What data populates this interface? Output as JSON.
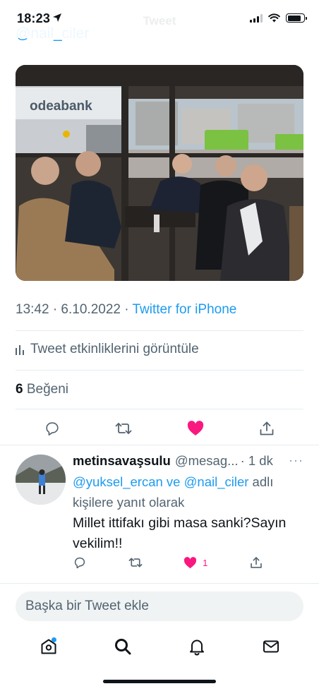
{
  "status_bar": {
    "time": "18:23",
    "battery_level": 0.85
  },
  "header": {
    "faded_title": "Tweet"
  },
  "tweet": {
    "cut_mention": "@nail_ciler",
    "timestamp": "13:42 · 6.10.2022 · ",
    "source": "Twitter for iPhone",
    "activity_label": "Tweet etkinliklerini görüntüle",
    "like_count": "6",
    "like_label": " Beğeni"
  },
  "reply": {
    "display_name": "metinsavaşsulu",
    "handle": "@mesag...",
    "time": " · 1 dk",
    "more": "···",
    "mention_1": "@yuksel_ercan",
    "connector": " ve ",
    "mention_2": "@nail_ciler",
    "reply_suffix": " adlı kişilere yanıt olarak",
    "text": "Millet ittifakı gibi masa sanki?Sayın vekilim!!",
    "like_count": "1"
  },
  "compose": {
    "placeholder": "Başka bir Tweet ekle"
  },
  "colors": {
    "accent": "#1d9bf0",
    "like": "#f91880",
    "text": "#0f1419",
    "secondary": "#536471"
  },
  "icons": [
    "location-arrow-icon",
    "signal-icon",
    "wifi-icon",
    "battery-icon",
    "reply-icon",
    "retweet-icon",
    "like-icon",
    "share-icon",
    "analytics-icon",
    "home-icon",
    "search-icon",
    "bell-icon",
    "mail-icon"
  ]
}
